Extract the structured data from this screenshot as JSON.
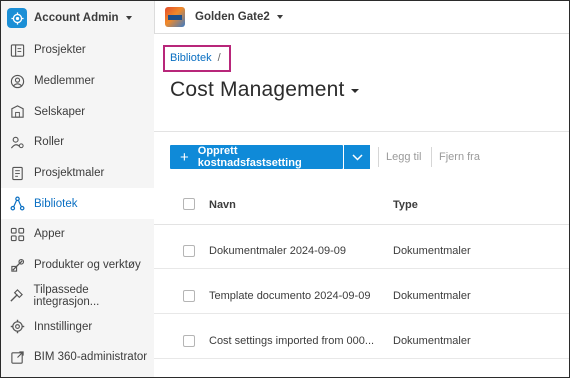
{
  "account": {
    "label": "Account Admin"
  },
  "sidebar": {
    "items": [
      {
        "label": "Prosjekter",
        "icon": "projects-icon",
        "active": false
      },
      {
        "label": "Medlemmer",
        "icon": "members-icon",
        "active": false
      },
      {
        "label": "Selskaper",
        "icon": "companies-icon",
        "active": false
      },
      {
        "label": "Roller",
        "icon": "roles-icon",
        "active": false
      },
      {
        "label": "Prosjektmaler",
        "icon": "project-templates-icon",
        "active": false
      },
      {
        "label": "Bibliotek",
        "icon": "library-icon",
        "active": true
      },
      {
        "label": "Apper",
        "icon": "apps-icon",
        "active": false
      },
      {
        "label": "Produkter og verktøy",
        "icon": "products-icon",
        "active": false
      },
      {
        "label": "Tilpassede integrasjon...",
        "icon": "integrations-icon",
        "active": false
      },
      {
        "label": "Innstillinger",
        "icon": "settings-icon",
        "active": false
      },
      {
        "label": "BIM 360-administrator",
        "icon": "external-link-icon",
        "active": false
      }
    ]
  },
  "topbar": {
    "project_name": "Golden Gate2"
  },
  "breadcrumb": {
    "link": "Bibliotek",
    "separator": "/"
  },
  "page": {
    "title": "Cost Management"
  },
  "actions": {
    "primary_label": "Opprett kostnadsfastsetting",
    "add_label": "Legg til",
    "remove_label": "Fjern fra"
  },
  "table": {
    "columns": [
      "Navn",
      "Type"
    ],
    "rows": [
      {
        "name": "Dokumentmaler 2024-09-09",
        "type": "Dokumentmaler"
      },
      {
        "name": "Template documento 2024-09-09",
        "type": "Dokumentmaler"
      },
      {
        "name": "Cost settings imported from 000...",
        "type": "Dokumentmaler"
      }
    ]
  },
  "colors": {
    "accent": "#0f8ad8",
    "link": "#0a6fc2",
    "highlight_box": "#b8267a"
  }
}
